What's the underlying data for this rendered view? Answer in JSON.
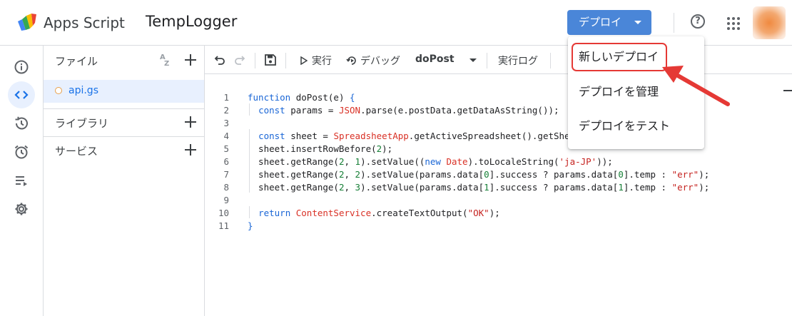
{
  "header": {
    "app_name": "Apps Script",
    "project_title": "TempLogger",
    "deploy_label": "デプロイ",
    "help_glyph": "?"
  },
  "nav": {
    "items": [
      "info-icon",
      "code-icon",
      "history-icon",
      "alarm-icon",
      "executions-icon",
      "settings-icon"
    ],
    "active": "code-icon"
  },
  "files": {
    "header_label": "ファイル",
    "sort_label_top": "A",
    "sort_label_bottom": "Z",
    "items": [
      {
        "name": "api.gs"
      }
    ],
    "libraries_label": "ライブラリ",
    "services_label": "サービス"
  },
  "toolbar": {
    "run_label": "実行",
    "debug_label": "デバッグ",
    "function_select": "doPost",
    "log_label": "実行ログ"
  },
  "editor": {
    "line_numbers": [
      "1",
      "2",
      "3",
      "4",
      "5",
      "6",
      "7",
      "8",
      "9",
      "10",
      "11"
    ]
  },
  "deploy_menu": {
    "items": [
      "新しいデプロイ",
      "デプロイを管理",
      "デプロイをテスト"
    ]
  },
  "colors": {
    "deploy_button": "#4a86d8",
    "accent": "#1a73e8",
    "highlight": "#e53935"
  }
}
